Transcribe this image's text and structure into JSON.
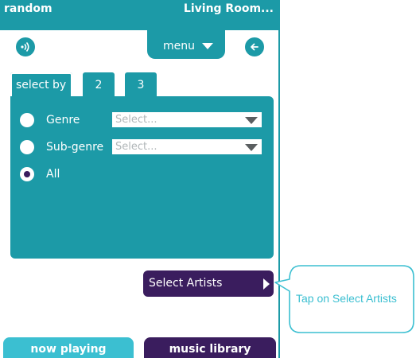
{
  "header": {
    "left_title": "random",
    "right_title": "Living Room..."
  },
  "toolbar": {
    "menu_label": "menu"
  },
  "icons": {
    "speaker": "speaker-icon",
    "back": "back-arrow-icon"
  },
  "tabs": [
    {
      "label": "select by"
    },
    {
      "label": "2"
    },
    {
      "label": "3"
    }
  ],
  "filters": {
    "genre": {
      "label": "Genre",
      "placeholder": "Select..."
    },
    "subgenre": {
      "label": "Sub-genre",
      "placeholder": "Select..."
    },
    "all": {
      "label": "All",
      "selected": true
    }
  },
  "actions": {
    "select_artists": "Select Artists"
  },
  "bottom_nav": {
    "now_playing": "now playing",
    "music_library": "music library"
  },
  "callout": {
    "text": "Tap on Select Artists"
  },
  "colors": {
    "teal": "#1c9aa7",
    "light_teal": "#3bbfd1",
    "purple": "#3a1d5e"
  }
}
